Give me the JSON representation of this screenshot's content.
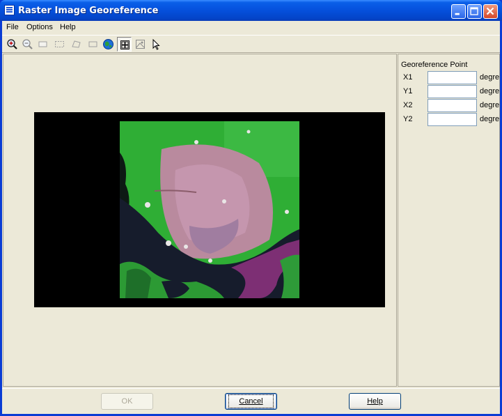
{
  "window": {
    "title": "Raster Image Georeference"
  },
  "menu": {
    "items": [
      "File",
      "Options",
      "Help"
    ]
  },
  "toolbar": {
    "tools": [
      {
        "name": "zoom-in-icon"
      },
      {
        "name": "zoom-out-icon"
      },
      {
        "name": "rectangle-icon"
      },
      {
        "name": "dashed-rectangle-icon"
      },
      {
        "name": "polygon-icon"
      },
      {
        "name": "rectangle-outline-icon"
      },
      {
        "name": "globe-icon"
      },
      {
        "name": "grid-icon",
        "pressed": true
      },
      {
        "name": "image-icon"
      },
      {
        "name": "arrow-pointer-icon"
      }
    ]
  },
  "georeference": {
    "title": "Georeference Point",
    "fields": [
      {
        "label": "X1",
        "value": "",
        "unit": "degrees"
      },
      {
        "label": "Y1",
        "value": "",
        "unit": "degrees"
      },
      {
        "label": "X2",
        "value": "",
        "unit": "degrees"
      },
      {
        "label": "Y2",
        "value": "",
        "unit": "degrees"
      }
    ]
  },
  "buttons": {
    "ok": "OK",
    "cancel": "Cancel",
    "help": "Help"
  }
}
